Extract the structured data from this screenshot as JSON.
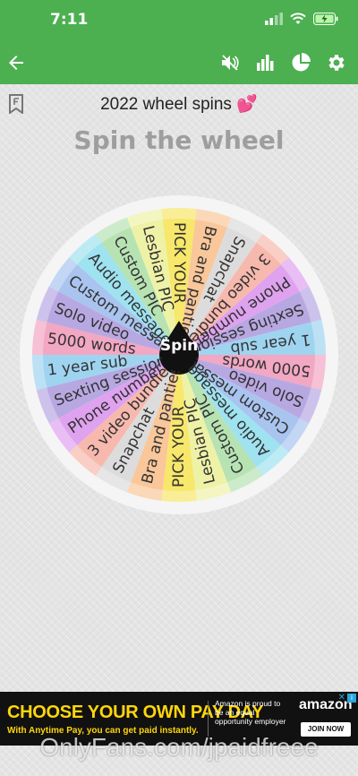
{
  "status": {
    "time": "7:11"
  },
  "header": {
    "title": "2022 wheel spins 💕",
    "heading": "Spin the wheel"
  },
  "toolbar": {
    "back_icon": "arrow-left-icon",
    "mute_icon": "volume-mute-icon",
    "stats_icon": "bar-chart-icon",
    "pie_icon": "pie-chart-icon",
    "settings_icon": "gear-icon"
  },
  "wheel": {
    "spin_label": "Spin",
    "rim_color": "#f5f5f5",
    "pointer_color": "#111111",
    "segments": [
      {
        "label": "PICK YOUR",
        "color": "#f7e76b"
      },
      {
        "label": "Bra and panties",
        "color": "#f9c79a"
      },
      {
        "label": "Snapchat",
        "color": "#dcdcdc"
      },
      {
        "label": "3 video bundle",
        "color": "#f7b9ad"
      },
      {
        "label": "Phone number",
        "color": "#dfa2ef"
      },
      {
        "label": "Sexting session",
        "color": "#b8a8e2"
      },
      {
        "label": "1 year sub",
        "color": "#9fd4f0"
      },
      {
        "label": "5000 words",
        "color": "#f2a7c3"
      },
      {
        "label": "Solo video",
        "color": "#b8a8e2"
      },
      {
        "label": "Custom message",
        "color": "#a9c4ef"
      },
      {
        "label": "Audio message",
        "color": "#9fe2f0"
      },
      {
        "label": "Custom PIC",
        "color": "#b7e3b3"
      },
      {
        "label": "Lesbian PIC",
        "color": "#eef2a6"
      },
      {
        "label": "PICK YOUR",
        "color": "#f7e76b"
      },
      {
        "label": "Bra and panties",
        "color": "#f9c79a"
      },
      {
        "label": "Snapchat",
        "color": "#dcdcdc"
      },
      {
        "label": "3 video bundle",
        "color": "#f7b9ad"
      },
      {
        "label": "Phone number",
        "color": "#dfa2ef"
      },
      {
        "label": "Sexting session",
        "color": "#b8a8e2"
      },
      {
        "label": "1 year sub",
        "color": "#9fd4f0"
      },
      {
        "label": "5000 words",
        "color": "#f2a7c3"
      },
      {
        "label": "Solo video",
        "color": "#b8a8e2"
      },
      {
        "label": "Custom message",
        "color": "#a9c4ef"
      },
      {
        "label": "Audio message",
        "color": "#9fe2f0"
      },
      {
        "label": "Custom PIC",
        "color": "#b7e3b3"
      },
      {
        "label": "Lesbian PIC",
        "color": "#eef2a6"
      }
    ]
  },
  "ad": {
    "headline": "CHOOSE YOUR OWN PAY DAY",
    "subline": "With Anytime Pay, you can get paid instantly.",
    "copy": "Amazon is proud to be an equal opportunity employer",
    "brand": "amazon",
    "cta": "JOIN NOW"
  },
  "watermark": "OnlyFans.com/jpaidfreee"
}
